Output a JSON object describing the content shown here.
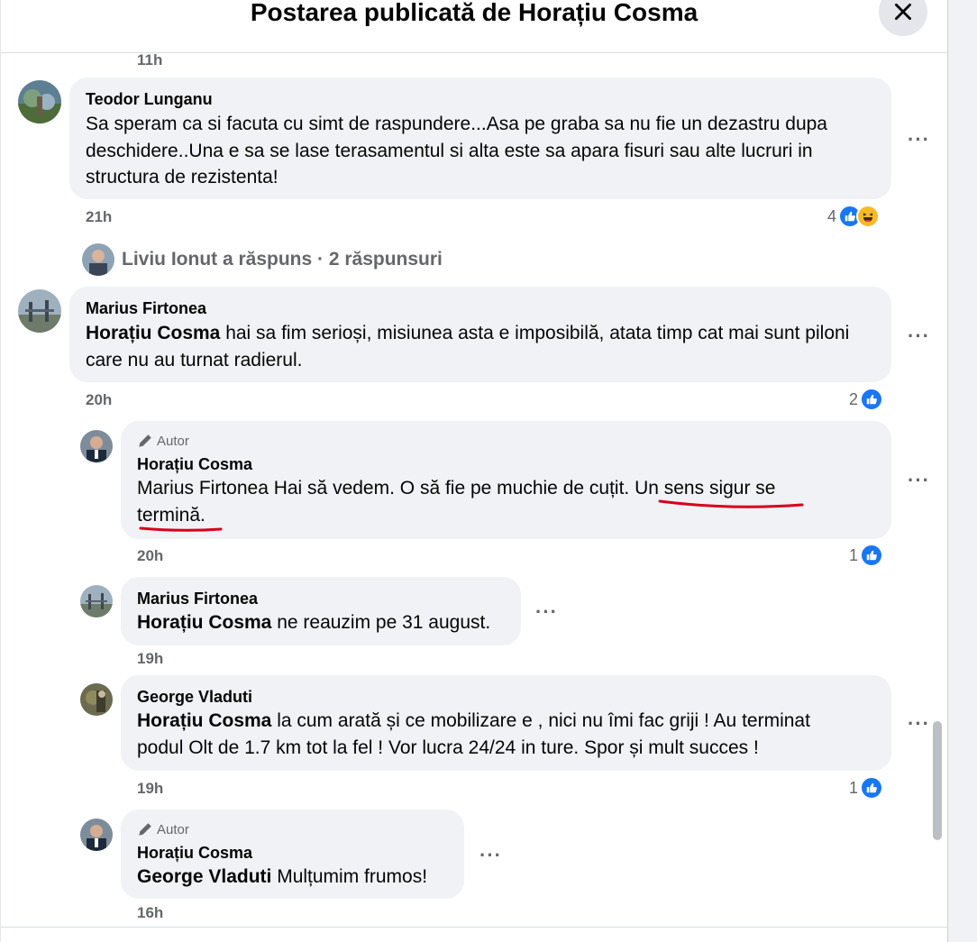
{
  "header": {
    "title": "Postarea publicată de Horațiu Cosma"
  },
  "top_timestamp": "11h",
  "comments": [
    {
      "author": "Teodor Lunganu",
      "text": "Sa speram ca si facuta cu simt de raspundere...Asa pe graba sa nu fie un dezastru dupa deschidere..Una e sa se lase terasamentul si alta este sa apara fisuri sau alte lucruri in structura de rezistenta!",
      "time": "21h",
      "reaction_count": "4",
      "reactions": [
        "like-icon",
        "haha-icon"
      ]
    },
    {
      "author": "Marius Firtonea",
      "mention": "Horațiu Cosma",
      "text": "hai sa fim serioși, misiunea asta e imposibilă, atata timp cat mai sunt piloni care nu au turnat radierul.",
      "time": "20h",
      "reaction_count": "2"
    }
  ],
  "replies_link": {
    "text": "Liviu Ionut a răspuns · 2 răspunsuri"
  },
  "replies": [
    {
      "badge": "Autor",
      "author": "Horațiu Cosma",
      "text_part1": "Marius Firtonea Hai să vedem. O să fie pe muchie de cuțit. Un sens sigur se",
      "text_part2": "termină.",
      "time": "20h",
      "reaction_count": "1"
    },
    {
      "author": "Marius Firtonea",
      "mention": "Horațiu Cosma",
      "text": "ne reauzim pe 31 august.",
      "time": "19h"
    },
    {
      "author": "George Vladuti",
      "mention": "Horațiu Cosma",
      "text_line1": "la cum arată și ce mobilizare e , nici nu îmi fac griji ! Au terminat",
      "text_line2": "podul Olt de 1.7 km tot la fel ! Vor lucra 24/24 in ture. Spor și mult succes !",
      "time": "19h",
      "reaction_count": "1"
    },
    {
      "badge": "Autor",
      "author": "Horațiu Cosma",
      "mention": "George Vladuti",
      "text": "Mulțumim frumos!",
      "time": "16h"
    }
  ],
  "colors": {
    "accent": "#1877f2",
    "underline": "#d6001c",
    "bubble": "#f0f2f5"
  }
}
